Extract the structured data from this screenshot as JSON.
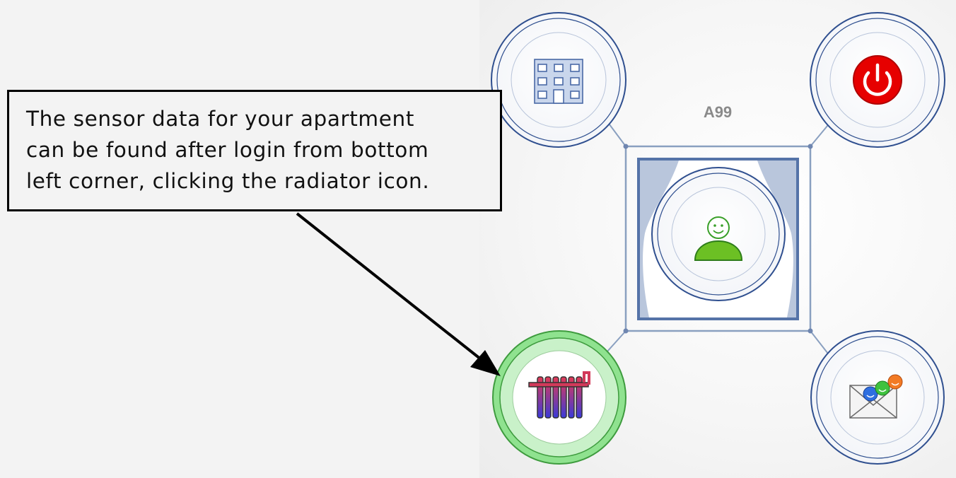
{
  "apartment": {
    "label": "A99"
  },
  "callout": {
    "lines": [
      "The sensor data for your apartment",
      "can be found after login from bottom",
      "left corner, clicking the radiator icon."
    ]
  },
  "nodes": {
    "building": {
      "icon": "building-icon"
    },
    "power": {
      "icon": "power-icon",
      "color": "#e60000"
    },
    "user": {
      "icon": "user-icon",
      "color": "#6cc024"
    },
    "radiator": {
      "icon": "radiator-icon",
      "highlight": "#7be07e"
    },
    "messages": {
      "icon": "mail-smileys-icon"
    }
  },
  "colors": {
    "ring": "#2f4f8f",
    "connector": "#8aa0c0",
    "window": "#5573a8"
  }
}
